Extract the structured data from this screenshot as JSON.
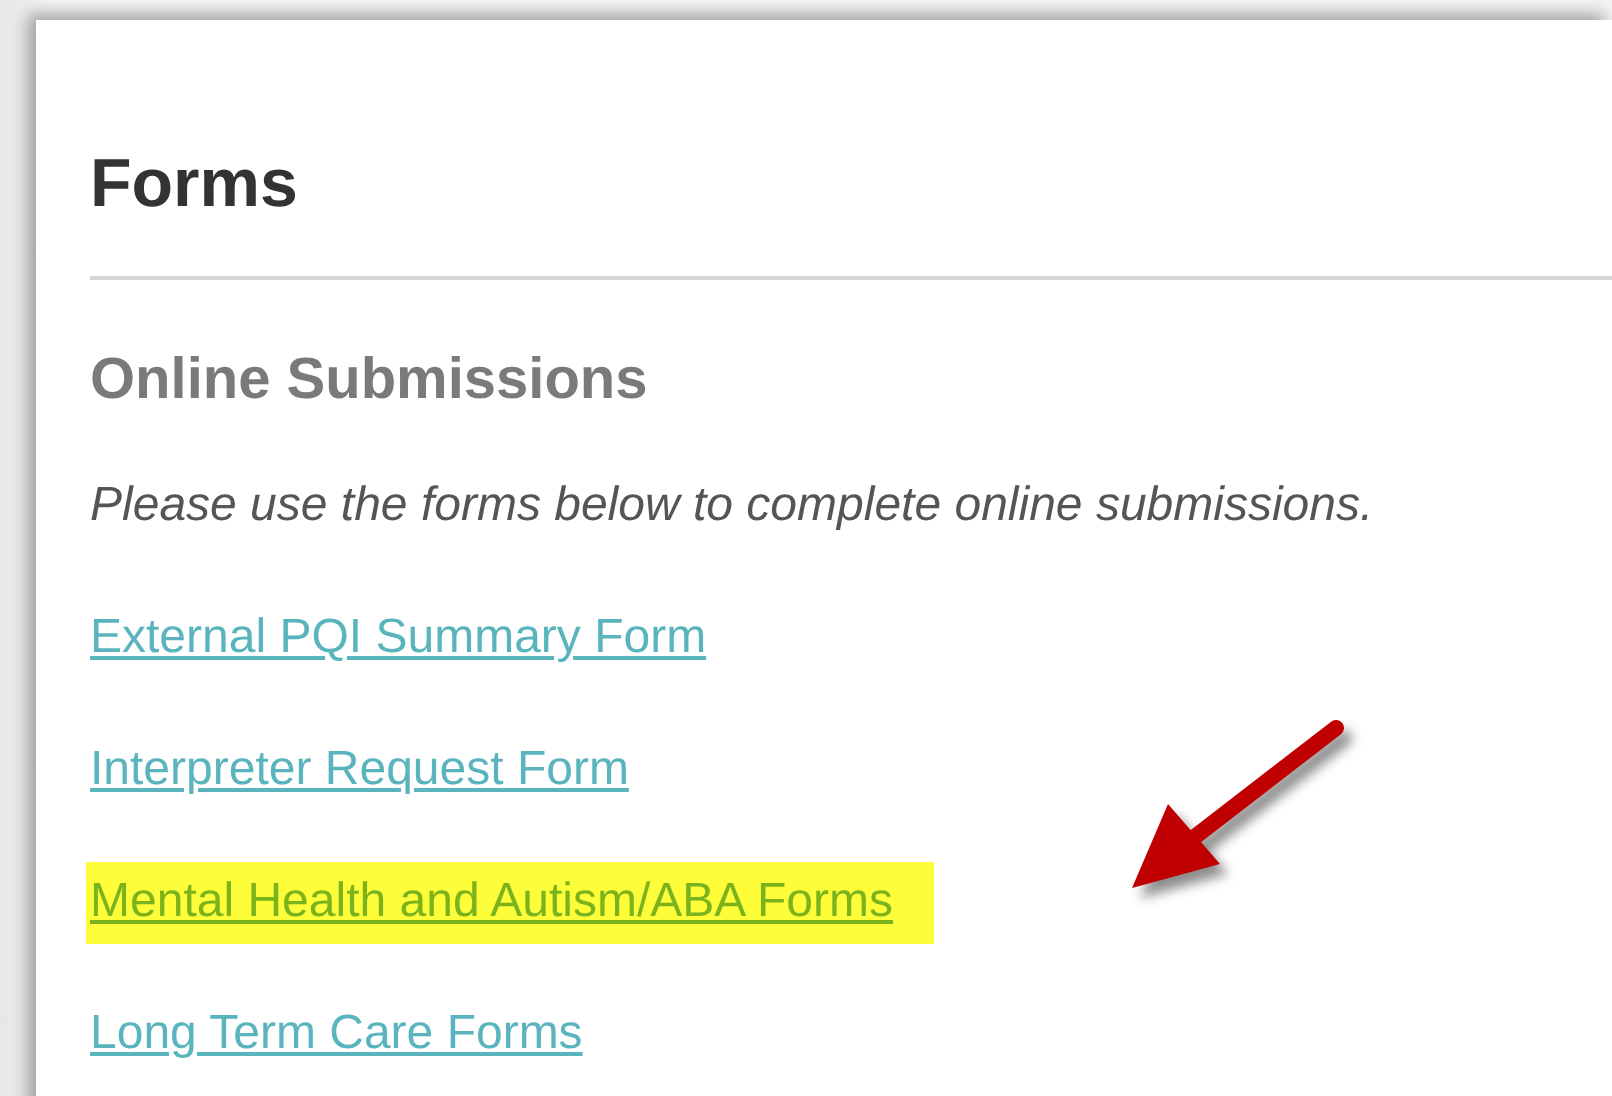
{
  "page": {
    "title": "Forms"
  },
  "section": {
    "heading": "Online Submissions",
    "intro": "Please use the forms below to complete online submissions."
  },
  "links": [
    {
      "label": "External PQI Summary Form",
      "highlighted": false
    },
    {
      "label": "Interpreter Request Form",
      "highlighted": false
    },
    {
      "label": "Mental Health and Autism/ABA Forms",
      "highlighted": true
    },
    {
      "label": "Long Term Care Forms",
      "highlighted": false
    }
  ]
}
